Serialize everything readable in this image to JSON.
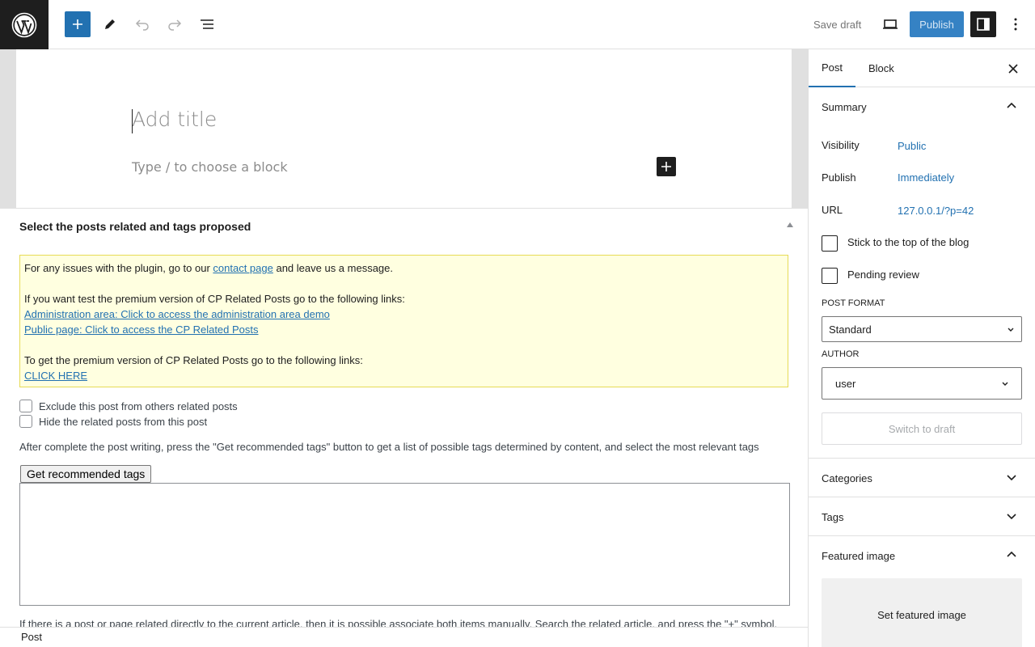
{
  "topbar": {
    "save_draft": "Save draft",
    "publish": "Publish",
    "icons": [
      "wordpress-logo",
      "plus-icon",
      "pencil-icon",
      "undo-icon",
      "redo-icon",
      "list-view-icon",
      "desktop-preview-icon",
      "sidebar-settings-icon",
      "more-vertical-icon"
    ]
  },
  "editor": {
    "title_placeholder": "Add title",
    "block_placeholder": "Type / to choose a block"
  },
  "metabox": {
    "title": "Select the posts related and tags proposed",
    "notice": {
      "line1_prefix": "For any issues with the plugin, go to our ",
      "line1_link": "contact page",
      "line1_suffix": " and leave us a message.",
      "line2": "If you want test the premium version of CP Related Posts go to the following links:",
      "admin_link": "Administration area: Click to access the administration area demo",
      "public_link": "Public page: Click to access the CP Related Posts",
      "line3": "To get the premium version of CP Related Posts go to the following links:",
      "click_here": "CLICK HERE"
    },
    "exclude_label": "Exclude this post from others related posts",
    "hide_label": "Hide the related posts from this post",
    "instructions": "After complete the post writing, press the \"Get recommended tags\" button to get a list of possible tags determined by content, and select the most relevant tags",
    "recommend_button": "Get recommended tags",
    "related_text": "If there is a post or page related directly to the current article, then it is possible associate both items manually. Search the related article, and press the \"+\" symbol."
  },
  "footer": {
    "breadcrumb": "Post"
  },
  "sidebar": {
    "tabs": [
      "Post",
      "Block"
    ],
    "summary": {
      "title": "Summary",
      "visibility_label": "Visibility",
      "visibility_value": "Public",
      "publish_label": "Publish",
      "publish_value": "Immediately",
      "url_label": "URL",
      "url_value": "127.0.0.1/?p=42",
      "sticky_label": "Stick to the top of the blog",
      "pending_label": "Pending review",
      "post_format_label": "POST FORMAT",
      "post_format_value": "Standard",
      "author_label": "AUTHOR",
      "author_value": "user",
      "switch_draft": "Switch to draft"
    },
    "categories": "Categories",
    "tags": "Tags",
    "featured_image": "Featured image",
    "set_featured": "Set featured image"
  },
  "colors": {
    "accent": "#2271b1",
    "publish_bg": "#3582c4",
    "dark": "#1e1e1e",
    "notice_bg": "#ffffe0"
  }
}
